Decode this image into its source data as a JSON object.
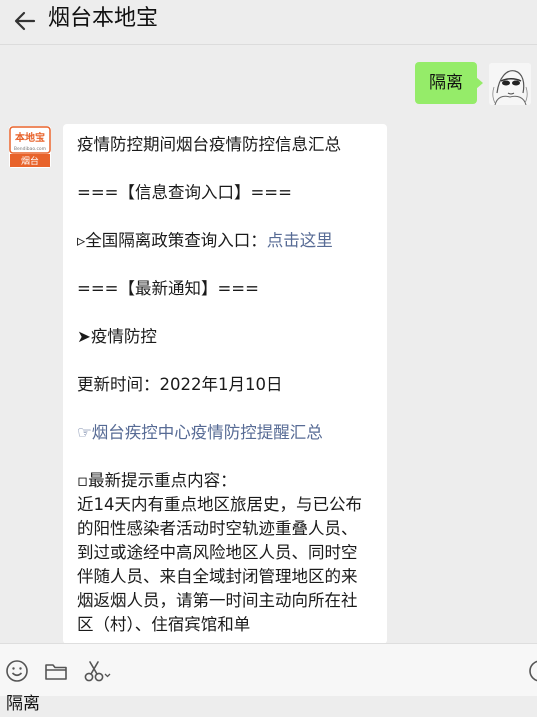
{
  "header": {
    "title": "烟台本地宝"
  },
  "messages": {
    "sent_text": "隔离",
    "received": {
      "heading": "疫情防控期间烟台疫情防控信息汇总",
      "section1": "===【信息查询入口】===",
      "entry_prefix": "▹全国隔离政策查询入口：",
      "entry_link": "点击这里",
      "section2": "===【最新通知】===",
      "topic": "➤疫情防控",
      "update_time": "更新时间：2022年1月10日",
      "notice_link": "☞烟台疾控中心疫情防控提醒汇总",
      "tips_title": "▫最新提示重点内容：",
      "tips_body": "近14天内有重点地区旅居史，与已公布的阳性感染者活动时空轨迹重叠人员、到过或途经中高风险地区人员、同时空伴随人员、来自全域封闭管理地区的来烟返烟人员，请第一时间主动向所在社区（村）、住宿宾馆和单"
    },
    "avatar_them_text_top": "本地宝",
    "avatar_them_text_mid": "Bendibao.com",
    "avatar_them_text_bot": "烟台"
  },
  "input": {
    "value": "隔离"
  },
  "colors": {
    "sent_bubble": "#95ec69",
    "link": "#576b95",
    "avatar_orange": "#e8632b"
  },
  "icons": {
    "back": "back-arrow-icon",
    "emoji": "emoji-icon",
    "folder": "folder-icon",
    "scissors": "scissors-icon"
  }
}
